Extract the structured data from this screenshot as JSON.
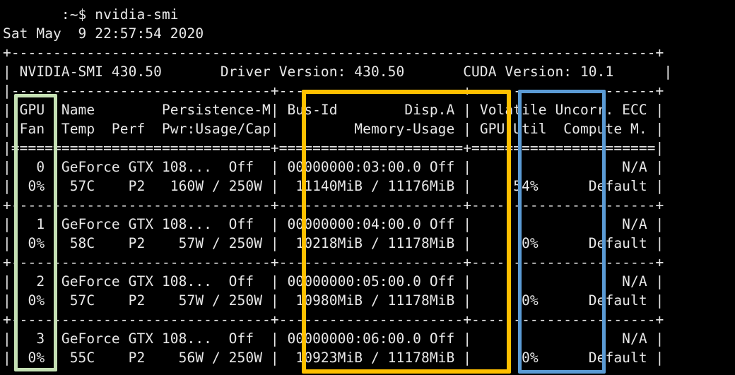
{
  "terminal": {
    "prompt_line": "       :~$ nvidia-smi",
    "timestamp_line": "Sat May  9 22:57:54 2020",
    "border_top": "+-----------------------------------------------------------------------------+",
    "header_info": "| NVIDIA-SMI 430.50       Driver Version: 430.50       CUDA Version: 10.1      |",
    "border_mid": "|-------------------------------+----------------------+----------------------+",
    "col_header_1": "| GPU  Name        Persistence-M| Bus-Id        Disp.A | Volatile Uncorr. ECC |",
    "col_header_2": "| Fan  Temp  Perf  Pwr:Usage/Cap|         Memory-Usage | GPU-Util  Compute M. |",
    "border_double": "|===============================+======================+======================|",
    "row_separator": "+-------------------------------+----------------------+----------------------+",
    "gpu_rows": [
      {
        "line1": "|   0  GeForce GTX 108...  Off  | 00000000:03:00.0 Off |                  N/A |",
        "line2": "|  0%   57C    P2   160W / 250W |  11140MiB / 11176MiB |     54%      Default |"
      },
      {
        "line1": "|   1  GeForce GTX 108...  Off  | 00000000:04:00.0 Off |                  N/A |",
        "line2": "|  0%   58C    P2    57W / 250W |  10218MiB / 11178MiB |      0%      Default |"
      },
      {
        "line1": "|   2  GeForce GTX 108...  Off  | 00000000:05:00.0 Off |                  N/A |",
        "line2": "|  0%   57C    P2    57W / 250W |  10980MiB / 11178MiB |      0%      Default |"
      },
      {
        "line1": "|   3  GeForce GTX 108...  Off  | 00000000:06:00.0 Off |                  N/A |",
        "line2": "|  0%   55C    P2    56W / 250W |  10923MiB / 11178MiB |      0%      Default |"
      }
    ]
  },
  "highlights": {
    "gpu_fan_color": "#c5e0b4",
    "bus_memory_color": "#ffc000",
    "util_color": "#5b9bd5"
  }
}
